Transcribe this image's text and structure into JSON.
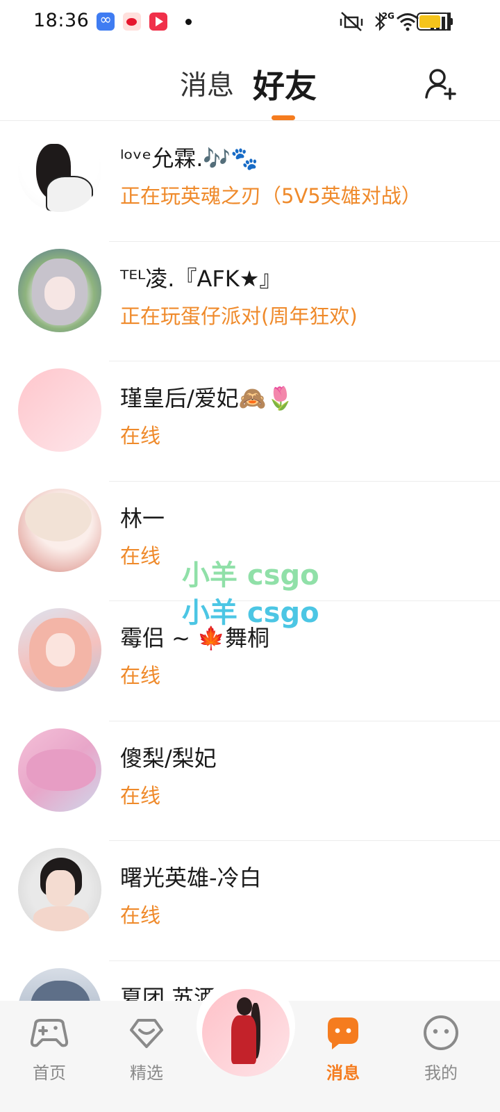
{
  "status_bar": {
    "time": "18:36",
    "network_label": "2G",
    "battery_level": 0.78,
    "battery_color": "#f5c41c",
    "app_icons": [
      "infinity-app-icon",
      "weibo-icon",
      "video-app-icon"
    ]
  },
  "header": {
    "tab_messages": "消息",
    "tab_friends": "好友",
    "active_tab": "好友",
    "accent_color": "#f57c1f",
    "add_friend_icon": "add-user-icon"
  },
  "friends": [
    {
      "name": "ˡᵒᵛᵉ允霖.🎶🐾",
      "status": "正在玩英魂之刃（5V5英雄对战）"
    },
    {
      "name": "ᵀᴱᴸ凌.『AFK★』",
      "status": "正在玩蛋仔派对(周年狂欢)"
    },
    {
      "name": "瑾皇后/爱妃🙈🌷",
      "status": "在线"
    },
    {
      "name": "林一",
      "status": "在线"
    },
    {
      "name": "霉侣 ~ 🍁舞桐",
      "status": "在线"
    },
    {
      "name": "傻梨/梨妃",
      "status": "在线"
    },
    {
      "name": "曙光英雄-冷白",
      "status": "在线"
    },
    {
      "name": "夏团 苏酒 女人",
      "status": ""
    }
  ],
  "watermark": {
    "line1": "小羊 csgo",
    "line2": "小羊 csgo"
  },
  "bottom_nav": {
    "home": "首页",
    "featured": "精选",
    "messages": "消息",
    "me": "我的",
    "active": "消息"
  }
}
